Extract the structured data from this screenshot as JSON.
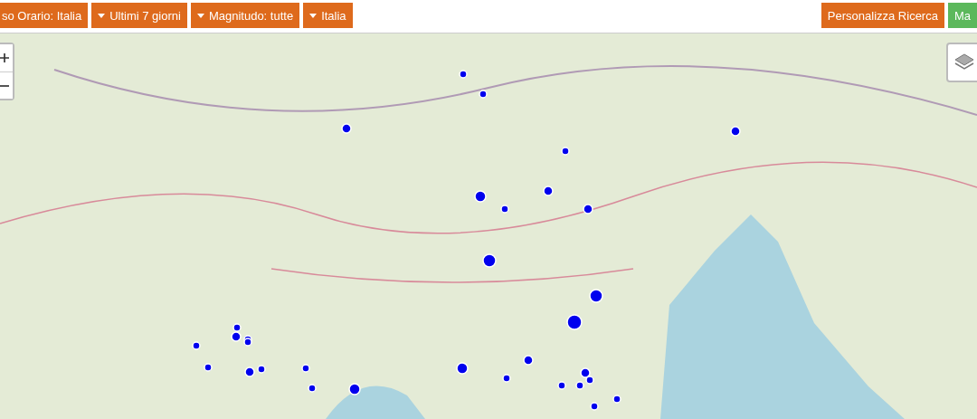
{
  "filters": [
    {
      "label": "so Orario: Italia",
      "kind": "plain"
    },
    {
      "label": "Ultimi 7 giorni",
      "kind": "dropdown"
    },
    {
      "label": "Magnitudo: tutte",
      "kind": "dropdown"
    },
    {
      "label": "Italia",
      "kind": "dropdown"
    }
  ],
  "actions": [
    {
      "label": "Personalizza Ricerca",
      "color": "#de6a1c"
    },
    {
      "label": "Ma",
      "color": "#5cb85c"
    }
  ]
}
